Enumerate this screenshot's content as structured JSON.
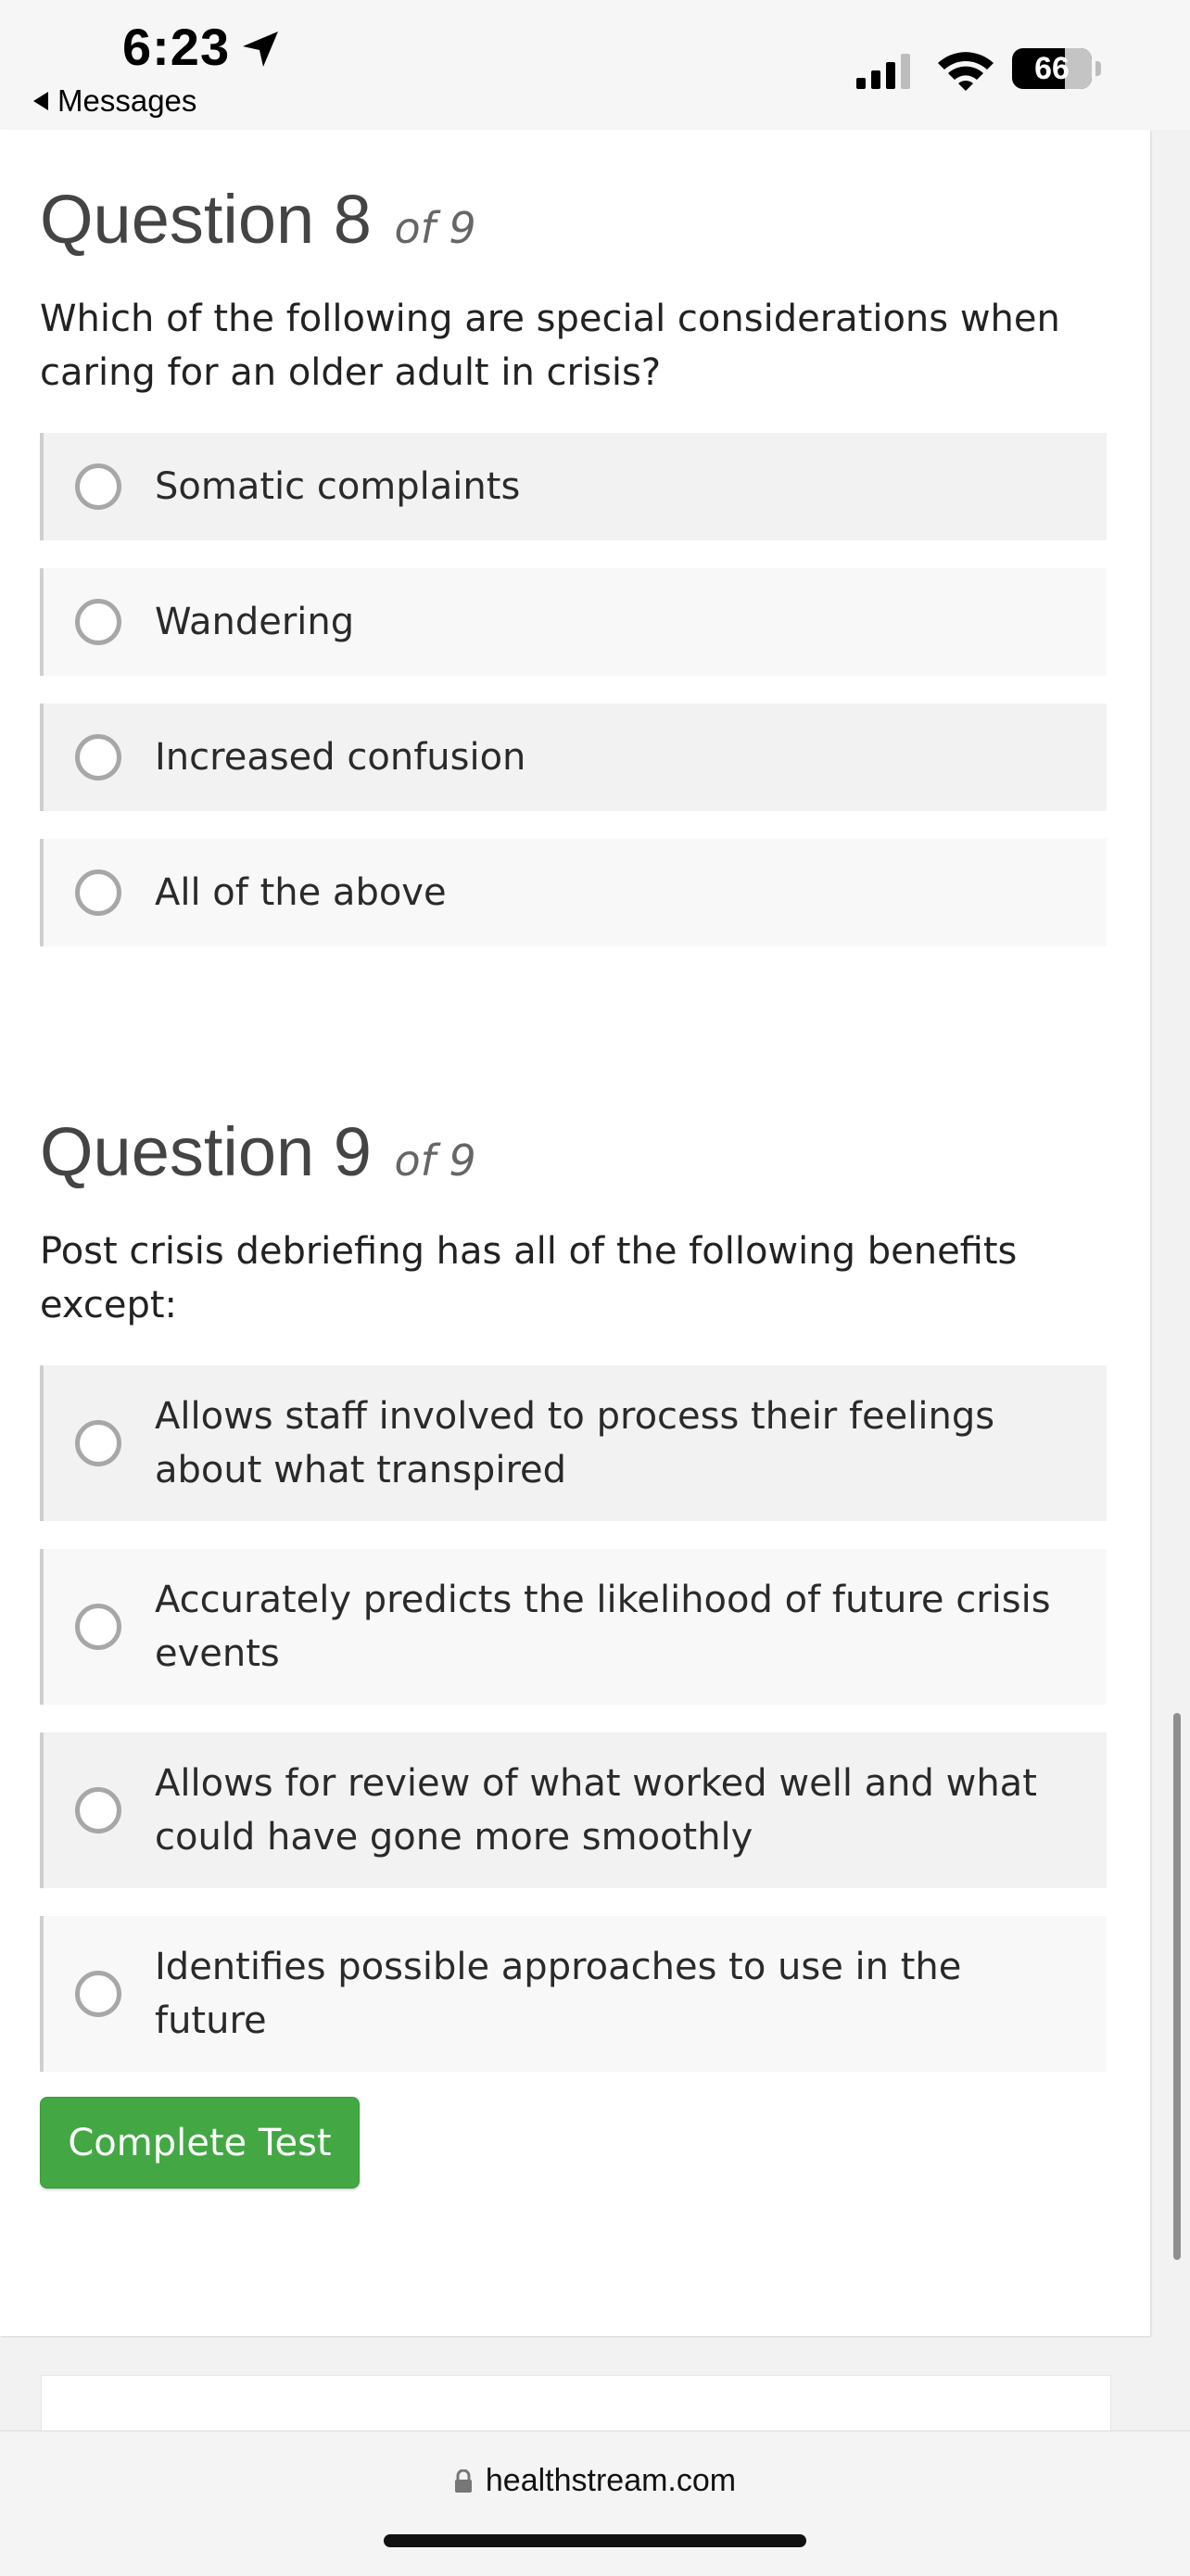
{
  "status_bar": {
    "time": "6:23",
    "back_label": "Messages",
    "battery": "66",
    "battery_level": 0.66
  },
  "questions": [
    {
      "heading": "Question 8",
      "of_label": "of 9",
      "text": "Which of the following are special considerations when caring for an older adult in crisis?",
      "options": [
        "Somatic complaints",
        "Wandering",
        "Increased confusion",
        "All of the above"
      ]
    },
    {
      "heading": "Question 9",
      "of_label": "of 9",
      "text": "Post crisis debriefing has all of the following benefits except:",
      "options": [
        "Allows staff involved to process their feelings about what transpired",
        "Accurately predicts the likelihood of future crisis events",
        "Allows for review of what worked well and what could have gone more smoothly",
        "Identifies possible approaches to use in the future"
      ]
    }
  ],
  "complete_button": "Complete Test",
  "browser": {
    "url": "healthstream.com"
  },
  "colors": {
    "button": "#43a843",
    "radio_border": "#a7a7a7",
    "option_bg": "#f2f2f2"
  }
}
